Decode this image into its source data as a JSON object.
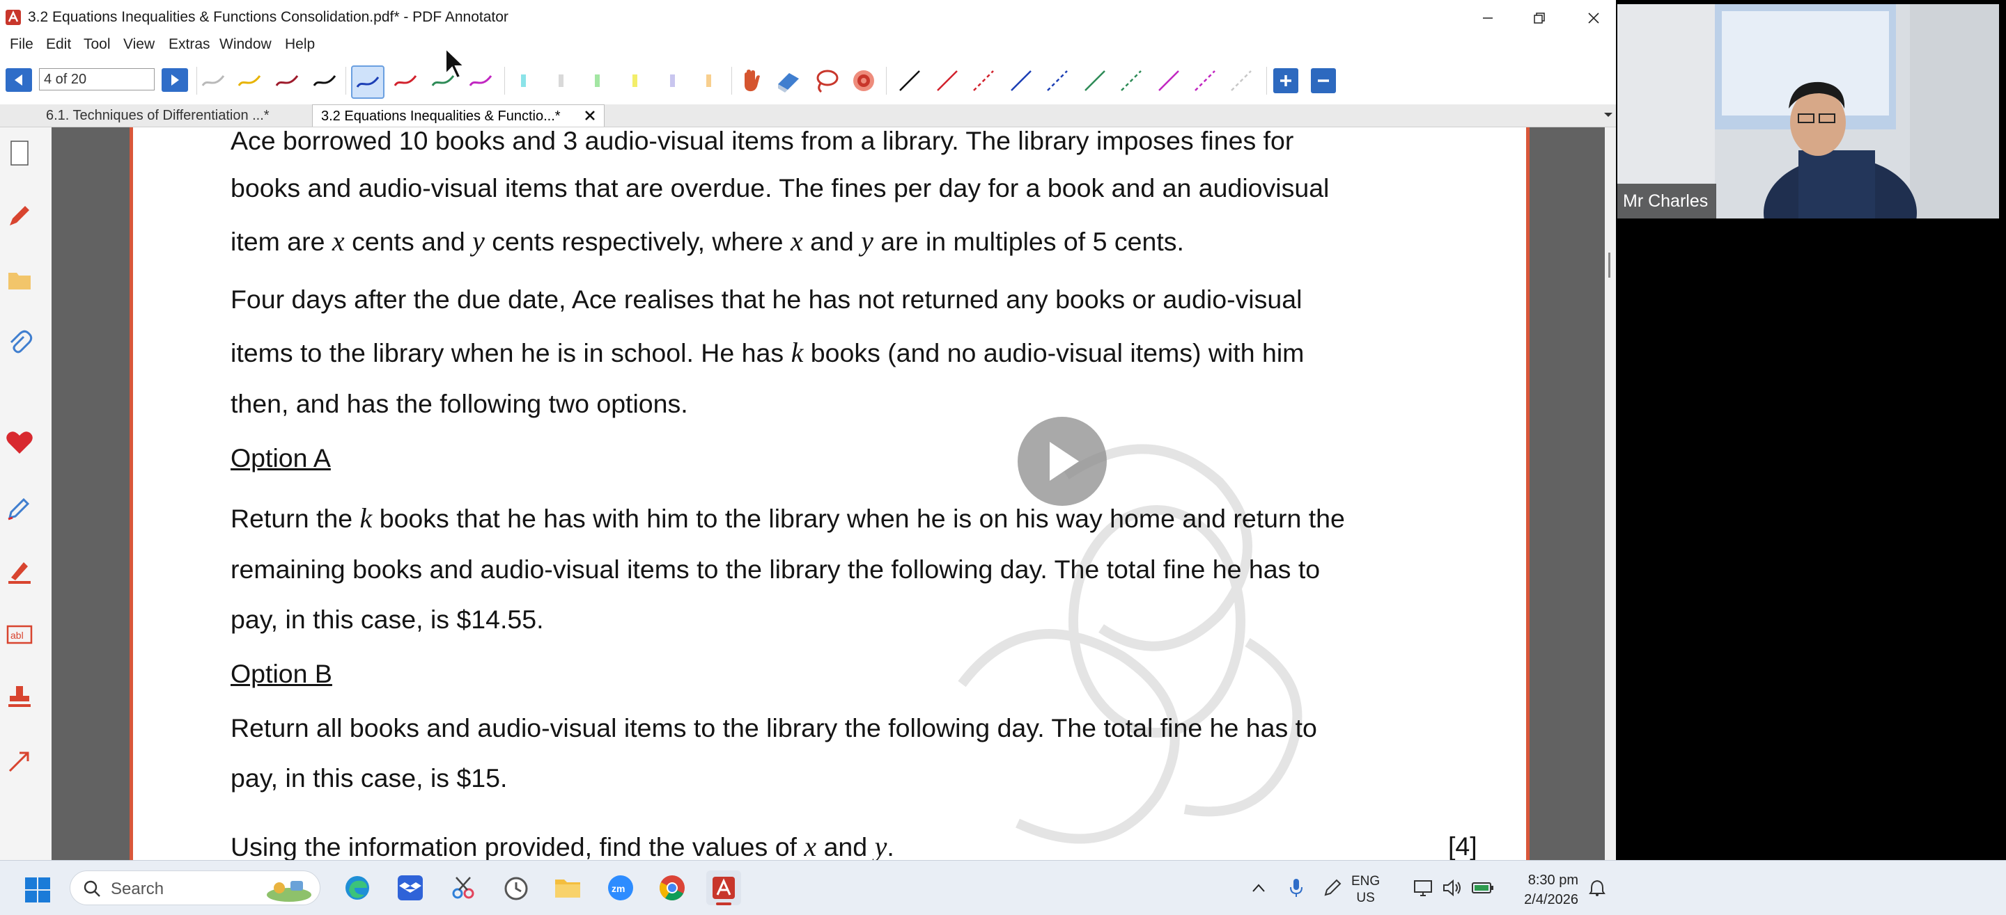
{
  "window": {
    "title": "3.2 Equations Inequalities & Functions Consolidation.pdf* - PDF Annotator"
  },
  "menu": [
    "File",
    "Edit",
    "Tool",
    "View",
    "Extras",
    "Window",
    "Help"
  ],
  "toolbar": {
    "page_indicator": "4 of 20"
  },
  "tabs": [
    {
      "label": "6.1. Techniques of Differentiation ...*",
      "active": false
    },
    {
      "label": "3.2 Equations Inequalities & Functio...*",
      "active": true
    }
  ],
  "document": {
    "intro_lines": [
      "Ace borrowed 10 books and 3 audio-visual items from a library. The library imposes fines for",
      "books and audio-visual items that are overdue. The fines per day for a book and an audiovisual"
    ],
    "line3": {
      "a": "item are ",
      "v1": "x",
      "b": " cents and ",
      "v2": "y",
      "c": " cents respectively, where ",
      "v3": "x",
      "d": " and ",
      "v4": "y",
      "e": " are in multiples of 5 cents."
    },
    "para2_line1": "Four days after the due date, Ace realises that he has not returned any books or audio-visual",
    "para2_line2": {
      "a": "items to the library when he is in school. He has ",
      "v": "k",
      "b": " books (and no audio-visual items) with him"
    },
    "para2_line3": "then, and has the following two options.",
    "option_a_title": "Option A",
    "option_a_line1": {
      "a": "Return the ",
      "v": "k",
      "b": " books that he has with him to the library when he is on his way home and return the"
    },
    "option_a_line2": "remaining books and audio-visual items to the library the following day. The total fine he has to",
    "option_a_line3": "pay, in this case, is $14.55.",
    "option_b_title": "Option B",
    "option_b_line1": "Return all books and audio-visual items to the library the following day. The total fine he has to",
    "option_b_line2": "pay, in this case, is $15.",
    "final_line": {
      "a": "Using the information provided, find the values of ",
      "v1": "x",
      "b": " and ",
      "v2": "y",
      "c": "."
    },
    "marks": "[4]"
  },
  "webcam": {
    "name": "Mr Charles"
  },
  "taskbar": {
    "search_placeholder": "Search",
    "lang_line1": "ENG",
    "lang_line2": "US",
    "time": "8:30 pm",
    "date": "2/4/2026"
  },
  "colors": {
    "accent_blue": "#2f6dc8",
    "page_border": "#d9573a",
    "doc_background": "#626262"
  }
}
